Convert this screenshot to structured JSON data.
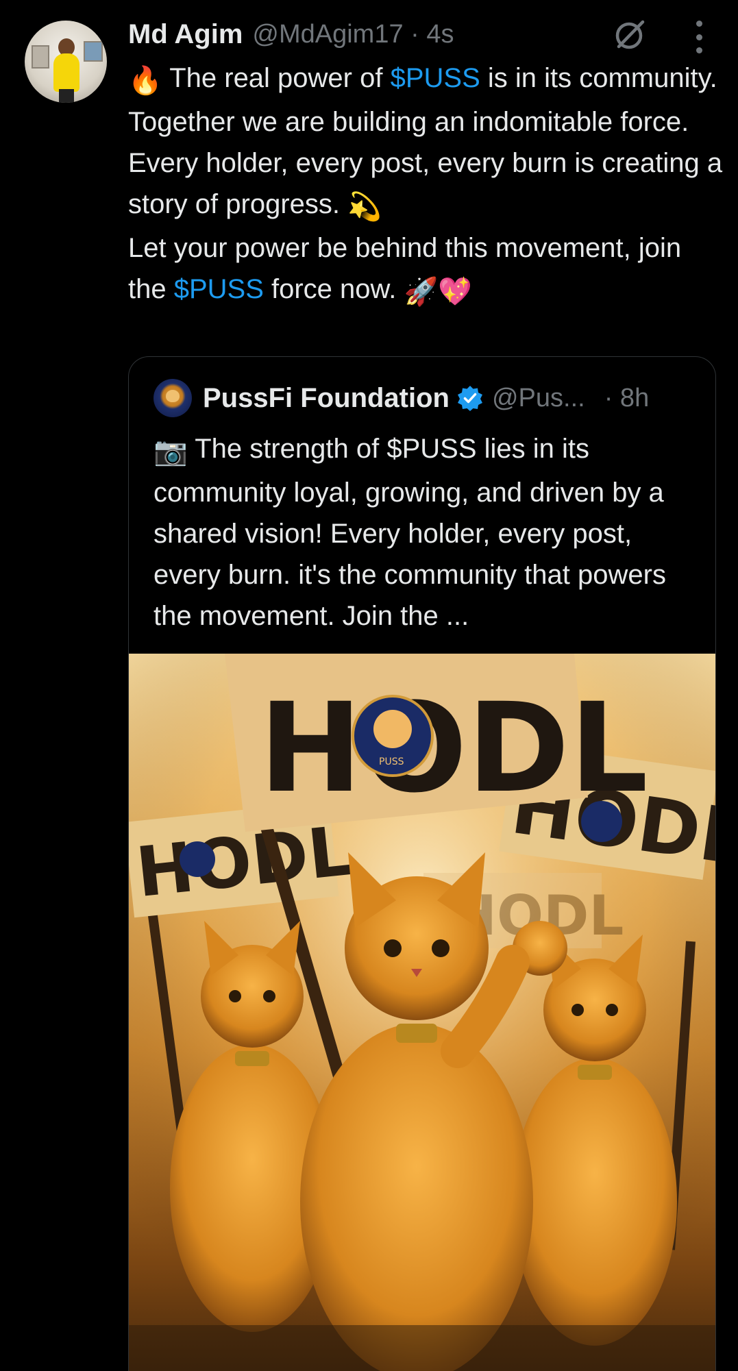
{
  "tweet": {
    "author_name": "Md Agim",
    "author_handle": "@MdAgim17",
    "separator": "·",
    "time": "4s",
    "text": {
      "line1_emoji": "🔥",
      "line1_a": " The real power of ",
      "line1_cashtag": "$PUSS",
      "line1_b": " is in its community. Together we are building an indomitable force. Every holder, every post, every burn is creating a story of progress. ",
      "line1_end_emoji": "💫",
      "line2_a": "Let your power be behind this movement, join the ",
      "line2_cashtag": "$PUSS",
      "line2_b": " force now. ",
      "line2_end_emoji": "🚀💖"
    }
  },
  "quoted_tweet": {
    "author_name": "PussFi Foundation",
    "author_handle": "@Pus...",
    "time": "· 8h",
    "text_emoji": "📷",
    "text": " The strength of $PUSS lies in its community loyal, growing, and driven by a shared vision! Every holder, every post, every burn. it's the community that powers the movement. Join the ...",
    "image": {
      "sign_text_main": "HODL",
      "sign_text_left": "HODL",
      "sign_text_right": "HODL",
      "sign_text_back": "HODL",
      "logo_caption": "PUSS"
    }
  },
  "colors": {
    "background": "#000000",
    "text": "#e7e9ea",
    "secondary": "#71767b",
    "link": "#1d9bf0",
    "verified": "#1d9bf0",
    "border": "#2f3336"
  },
  "icons": {
    "grok": "grok-icon",
    "more": "more-vertical-icon",
    "verified": "verified-badge-icon"
  }
}
